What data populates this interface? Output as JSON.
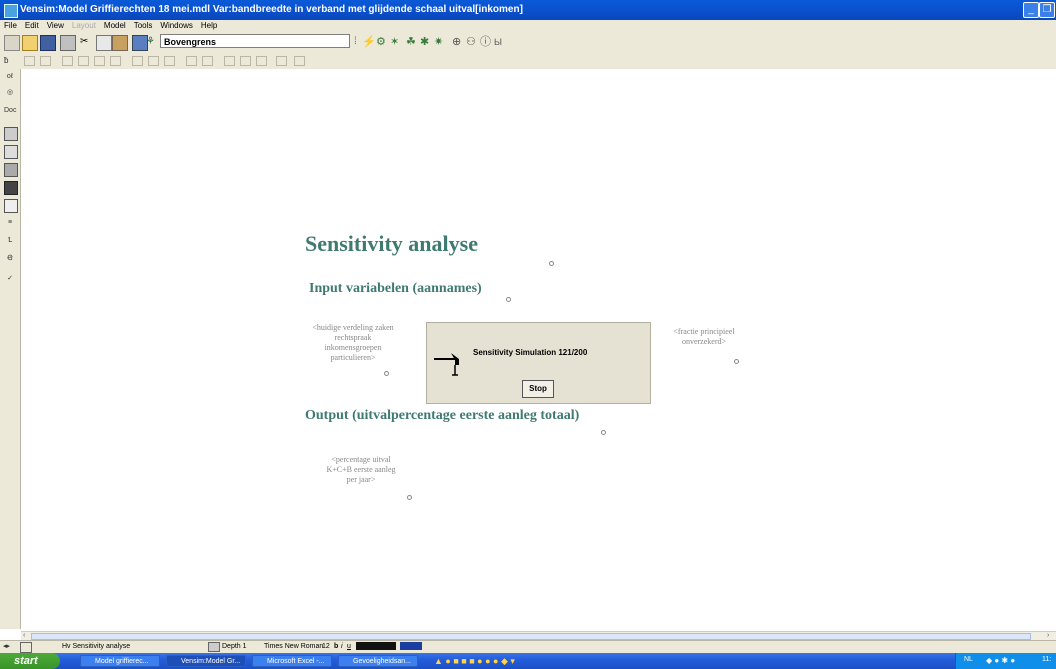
{
  "window": {
    "title": "Vensim:Model Griffierechten 18 mei.mdl Var:bandbreedte in verband met glijdende schaal uitval[inkomen]"
  },
  "menu": {
    "items": [
      "File",
      "Edit",
      "View",
      "Layout",
      "Model",
      "Tools",
      "Windows",
      "Help"
    ]
  },
  "toolbar": {
    "variable_field": "Bovengrens"
  },
  "canvas": {
    "heading": "Sensitivity analyse",
    "section_input": "Input variabelen (aannames)",
    "section_output": "Output (uitvalpercentage eerste aanleg totaal)",
    "shadow_var_1": "<huidige verdeling zaken rechtspraak inkomensgroepen particulieren>",
    "shadow_var_2": "<fractie principieel onverzekerd>",
    "shadow_var_3": "<percentage uitval K+C+B eerste aanleg per jaar>"
  },
  "dialog": {
    "message": "Sensitivity Simulation 121/200",
    "stop_label": "Stop"
  },
  "statusbar": {
    "view": "Hv  Sensitivity analyse",
    "depth": "Depth 1",
    "font": "Times New Roman",
    "size": "12"
  },
  "taskbar": {
    "start_label": "start",
    "tasks": [
      "Model griffierec...",
      "Vensim:Model Gr...",
      "Microsoft Excel -...",
      "Gevoeligheidsan..."
    ],
    "clock": "11:"
  },
  "colors": {
    "heading": "#3f7a70",
    "titlebar": "#0b4fcb",
    "taskbar": "#245edb"
  }
}
